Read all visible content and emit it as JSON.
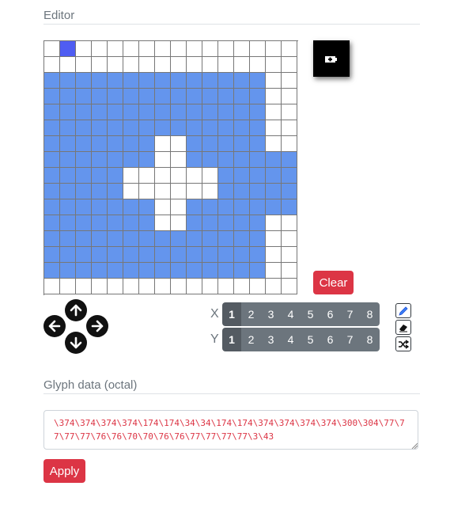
{
  "editor": {
    "title": "Editor"
  },
  "grid": {
    "size": 16,
    "rows": [
      "0000000000000000",
      "0000000000000000",
      "1111111111111100",
      "1111111111111100",
      "1111111111111100",
      "1111111111111100",
      "1111111001111100",
      "1111111001111111",
      "1111100000011111",
      "1111100000011111",
      "1111111001111111",
      "1111111001111100",
      "1111111111111100",
      "1111111111111100",
      "1111111111111100",
      "0000000000000000"
    ],
    "cursor": {
      "row": 0,
      "col": 1
    },
    "on_color": "#6495ed",
    "cursor_color": "#4f5df2"
  },
  "preview": {
    "icon": "battery-plus-icon"
  },
  "buttons": {
    "clear_label": "Clear",
    "apply_label": "Apply"
  },
  "navigation": {
    "icons": [
      "arrow-up-icon",
      "arrow-left-icon",
      "arrow-right-icon",
      "arrow-down-icon"
    ]
  },
  "x_axis": {
    "label": "X",
    "options": [
      "1",
      "2",
      "3",
      "4",
      "5",
      "6",
      "7",
      "8"
    ],
    "selected": "1"
  },
  "y_axis": {
    "label": "Y",
    "options": [
      "1",
      "2",
      "3",
      "4",
      "5",
      "6",
      "7",
      "8"
    ],
    "selected": "1"
  },
  "tools": [
    "pencil-icon",
    "eraser-icon",
    "shuffle-icon"
  ],
  "glyph": {
    "title": "Glyph data (octal)",
    "value": "\\374\\374\\374\\374\\174\\174\\34\\34\\174\\174\\374\\374\\374\\374\\300\\304\\77\\77\\77\\77\\76\\76\\70\\70\\76\\76\\77\\77\\77\\77\\3\\43"
  },
  "colors": {
    "accent": "#dc3545",
    "secondary": "#6c757d"
  }
}
